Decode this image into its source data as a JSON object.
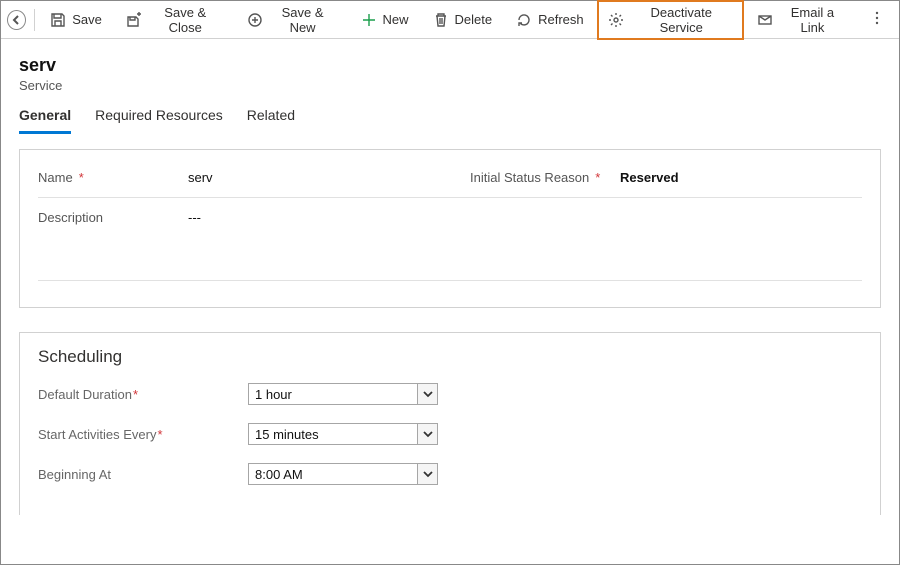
{
  "toolbar": {
    "save": "Save",
    "save_close": "Save & Close",
    "save_new": "Save & New",
    "new": "New",
    "delete": "Delete",
    "refresh": "Refresh",
    "deactivate": "Deactivate Service",
    "email_link": "Email a Link"
  },
  "record": {
    "title": "serv",
    "entity": "Service"
  },
  "tabs": {
    "general": "General",
    "required_resources": "Required Resources",
    "related": "Related"
  },
  "fields": {
    "name_label": "Name",
    "name_value": "serv",
    "status_label": "Initial Status Reason",
    "status_value": "Reserved",
    "description_label": "Description",
    "description_value": "---"
  },
  "scheduling": {
    "title": "Scheduling",
    "default_duration_label": "Default Duration",
    "default_duration_value": "1 hour",
    "start_every_label": "Start Activities Every",
    "start_every_value": "15 minutes",
    "beginning_at_label": "Beginning At",
    "beginning_at_value": "8:00 AM"
  }
}
